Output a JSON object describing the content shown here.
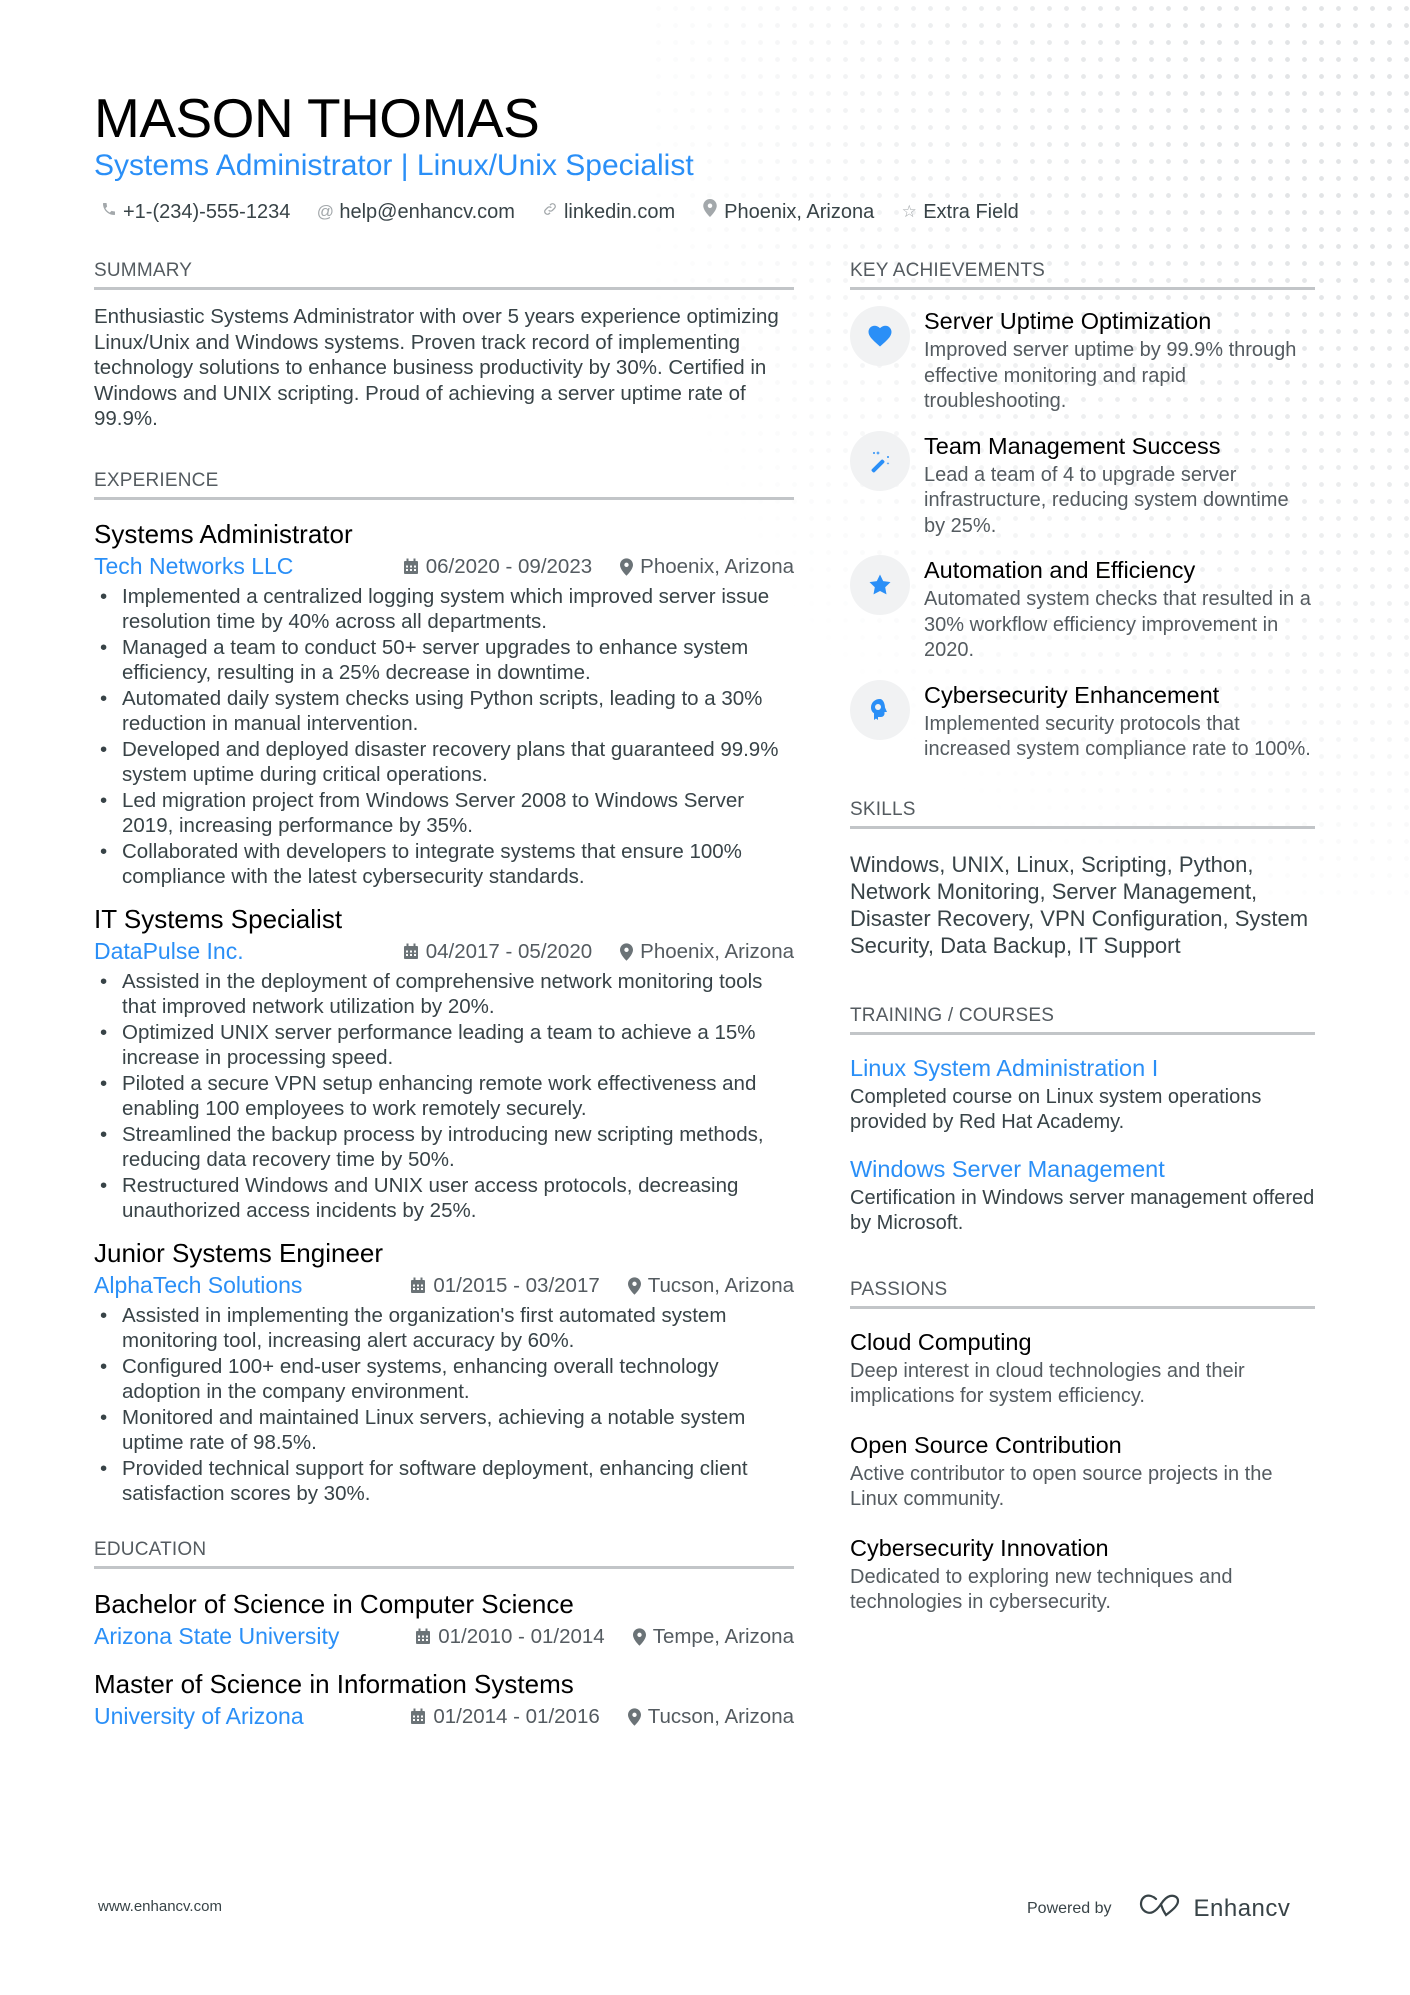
{
  "header": {
    "name": "MASON THOMAS",
    "title": "Systems Administrator | Linux/Unix Specialist",
    "contacts": [
      {
        "icon": "phone-icon",
        "glyph": "✆",
        "text": "+1-(234)-555-1234"
      },
      {
        "icon": "at-icon",
        "glyph": "@",
        "text": "help@enhancv.com"
      },
      {
        "icon": "link-icon",
        "glyph": "↗",
        "text": "linkedin.com"
      },
      {
        "icon": "location-icon",
        "glyph": "●",
        "text": "Phoenix, Arizona"
      },
      {
        "icon": "star-outline-icon",
        "glyph": "☆",
        "text": "Extra Field"
      }
    ]
  },
  "summary": {
    "heading": "SUMMARY",
    "text": "Enthusiastic Systems Administrator with over 5 years experience optimizing Linux/Unix and Windows systems. Proven track record of implementing technology solutions to enhance business productivity by 30%. Certified in Windows and UNIX scripting. Proud of achieving a server uptime rate of 99.9%."
  },
  "experience": {
    "heading": "EXPERIENCE",
    "jobs": [
      {
        "title": "Systems Administrator",
        "company": "Tech Networks LLC",
        "dates": "06/2020 - 09/2023",
        "location": "Phoenix, Arizona",
        "bullets": [
          "Implemented a centralized logging system which improved server issue resolution time by 40% across all departments.",
          "Managed a team to conduct 50+ server upgrades to enhance system efficiency, resulting in a 25% decrease in downtime.",
          "Automated daily system checks using Python scripts, leading to a 30% reduction in manual intervention.",
          "Developed and deployed disaster recovery plans that guaranteed 99.9% system uptime during critical operations.",
          "Led migration project from Windows Server 2008 to Windows Server 2019, increasing performance by 35%.",
          "Collaborated with developers to integrate systems that ensure 100% compliance with the latest cybersecurity standards."
        ]
      },
      {
        "title": "IT Systems Specialist",
        "company": "DataPulse Inc.",
        "dates": "04/2017 - 05/2020",
        "location": "Phoenix, Arizona",
        "bullets": [
          "Assisted in the deployment of comprehensive network monitoring tools that improved network utilization by 20%.",
          "Optimized UNIX server performance leading a team to achieve a 15% increase in processing speed.",
          "Piloted a secure VPN setup enhancing remote work effectiveness and enabling 100 employees to work remotely securely.",
          "Streamlined the backup process by introducing new scripting methods, reducing data recovery time by 50%.",
          "Restructured Windows and UNIX user access protocols, decreasing unauthorized access incidents by 25%."
        ]
      },
      {
        "title": "Junior Systems Engineer",
        "company": "AlphaTech Solutions",
        "dates": "01/2015 - 03/2017",
        "location": "Tucson, Arizona",
        "bullets": [
          "Assisted in implementing the organization's first automated system monitoring tool, increasing alert accuracy by 60%.",
          "Configured 100+ end-user systems, enhancing overall technology adoption in the company environment.",
          "Monitored and maintained Linux servers, achieving a notable system uptime rate of 98.5%.",
          "Provided technical support for software deployment, enhancing client satisfaction scores by 30%."
        ]
      }
    ]
  },
  "education": {
    "heading": "EDUCATION",
    "items": [
      {
        "degree": "Bachelor of Science in Computer Science",
        "school": "Arizona State University",
        "dates": "01/2010 - 01/2014",
        "location": "Tempe, Arizona"
      },
      {
        "degree": "Master of Science in Information Systems",
        "school": "University of Arizona",
        "dates": "01/2014 - 01/2016",
        "location": "Tucson, Arizona"
      }
    ]
  },
  "achievements": {
    "heading": "KEY ACHIEVEMENTS",
    "items": [
      {
        "icon": "heart-icon",
        "title": "Server Uptime Optimization",
        "desc": "Improved server uptime by 99.9% through effective monitoring and rapid troubleshooting."
      },
      {
        "icon": "magic-wand-icon",
        "title": "Team Management Success",
        "desc": "Lead a team of 4 to upgrade server infrastructure, reducing system downtime by 25%."
      },
      {
        "icon": "star-icon",
        "title": "Automation and Efficiency",
        "desc": "Automated system checks that resulted in a 30% workflow efficiency improvement in 2020."
      },
      {
        "icon": "head-brain-icon",
        "title": "Cybersecurity Enhancement",
        "desc": "Implemented security protocols that increased system compliance rate to 100%."
      }
    ]
  },
  "skills": {
    "heading": "SKILLS",
    "text": "Windows, UNIX, Linux, Scripting, Python, Network Monitoring, Server Management, Disaster Recovery, VPN Configuration, System Security, Data Backup, IT Support"
  },
  "training": {
    "heading": "TRAINING / COURSES",
    "items": [
      {
        "title": "Linux System Administration I",
        "desc": "Completed course on Linux system operations provided by Red Hat Academy."
      },
      {
        "title": "Windows Server Management",
        "desc": "Certification in Windows server management offered by Microsoft."
      }
    ]
  },
  "passions": {
    "heading": "PASSIONS",
    "items": [
      {
        "title": "Cloud Computing",
        "desc": "Deep interest in cloud technologies and their implications for system efficiency."
      },
      {
        "title": "Open Source Contribution",
        "desc": "Active contributor to open source projects in the Linux community."
      },
      {
        "title": "Cybersecurity Innovation",
        "desc": "Dedicated to exploring new techniques and technologies in cybersecurity."
      }
    ]
  },
  "footer": {
    "website": "www.enhancv.com",
    "powered_by": "Powered by",
    "brand": "Enhancv"
  },
  "colors": {
    "accent": "#2a8ff7",
    "text": "#384347",
    "heading_rule": "#c2c5c8",
    "icon_bg": "#f1f2f3"
  }
}
